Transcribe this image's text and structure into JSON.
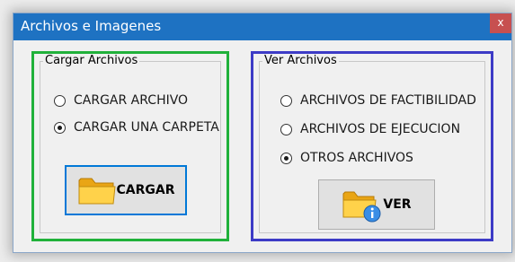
{
  "window": {
    "title": "Archivos e Imagenes",
    "close_glyph": "x"
  },
  "upload_group": {
    "title": "Cargar Archivos",
    "options": [
      {
        "label": "CARGAR ARCHIVO",
        "checked": false
      },
      {
        "label": "CARGAR UNA CARPETA",
        "checked": true
      }
    ],
    "button_label": "CARGAR",
    "button_icon": "folder-icon"
  },
  "view_group": {
    "title": "Ver Archivos",
    "options": [
      {
        "label": "ARCHIVOS DE FACTIBILIDAD",
        "checked": false
      },
      {
        "label": "ARCHIVOS DE EJECUCION",
        "checked": false
      },
      {
        "label": "OTROS ARCHIVOS",
        "checked": true
      }
    ],
    "button_label": "VER",
    "button_icon": "folder-info-icon"
  },
  "colors": {
    "titlebar": "#1e72c2",
    "close": "#c75050",
    "highlight_green": "#20b13a",
    "highlight_blue": "#3d3bc6",
    "focus": "#0078d7"
  }
}
